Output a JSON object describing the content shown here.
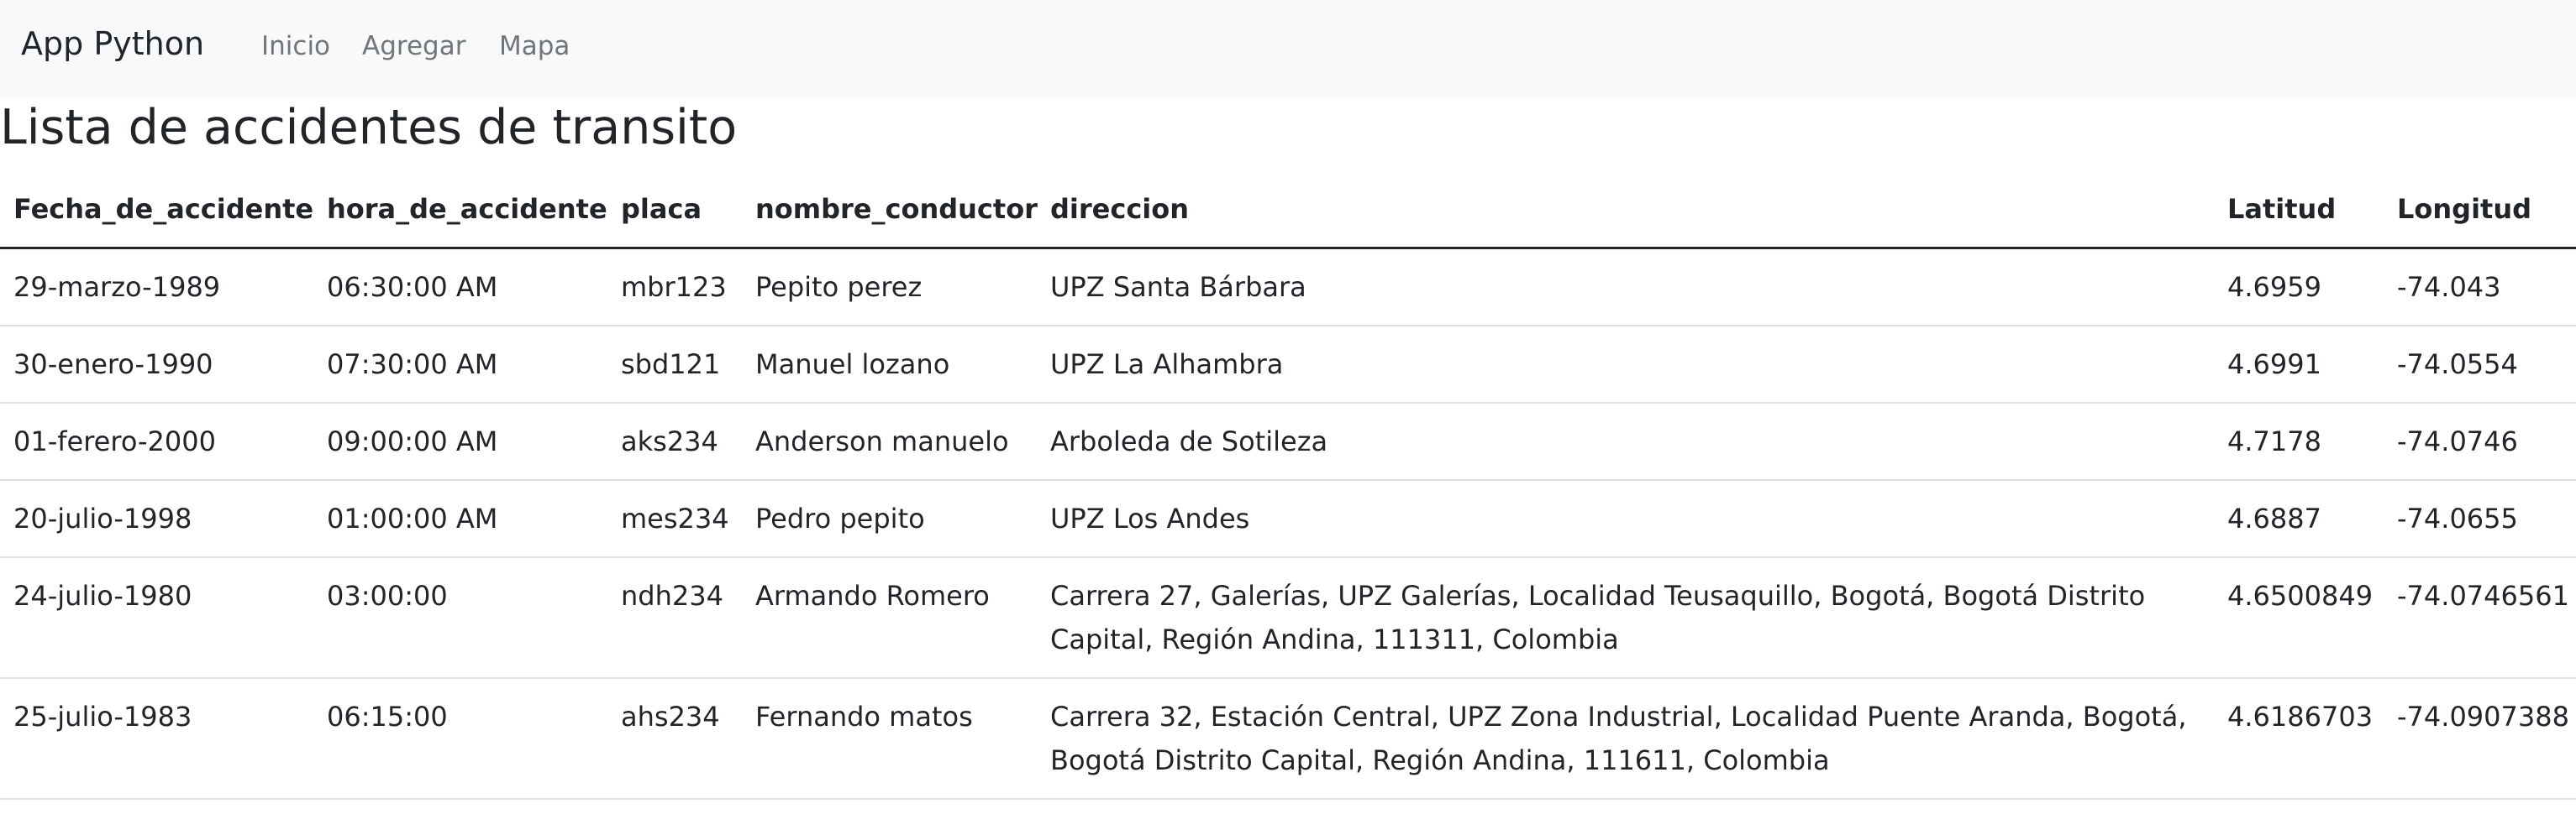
{
  "navbar": {
    "brand": "App Python",
    "links": [
      "Inicio",
      "Agregar",
      "Mapa"
    ]
  },
  "title": "Lista de accidentes de transito",
  "table": {
    "headers": [
      "Fecha_de_accidente",
      "hora_de_accidente",
      "placa",
      "nombre_conductor",
      "direccion",
      "Latitud",
      "Longitud"
    ],
    "rows": [
      [
        "29-marzo-1989",
        "06:30:00 AM",
        "mbr123",
        "Pepito perez",
        "UPZ Santa Bárbara",
        "4.6959",
        "-74.043"
      ],
      [
        "30-enero-1990",
        "07:30:00 AM",
        "sbd121",
        "Manuel lozano",
        "UPZ La Alhambra",
        "4.6991",
        "-74.0554"
      ],
      [
        "01-ferero-2000",
        "09:00:00 AM",
        "aks234",
        "Anderson manuelo",
        "Arboleda de Sotileza",
        "4.7178",
        "-74.0746"
      ],
      [
        "20-julio-1998",
        "01:00:00 AM",
        "mes234",
        "Pedro pepito",
        "UPZ Los Andes",
        "4.6887",
        "-74.0655"
      ],
      [
        "24-julio-1980",
        "03:00:00",
        "ndh234",
        "Armando Romero",
        "Carrera 27, Galerías, UPZ Galerías, Localidad Teusaquillo, Bogotá, Bogotá Distrito Capital, Región Andina, 111311, Colombia",
        "4.6500849",
        "-74.0746561"
      ],
      [
        "25-julio-1983",
        "06:15:00",
        "ahs234",
        "Fernando matos",
        "Carrera 32, Estación Central, UPZ Zona Industrial, Localidad Puente Aranda, Bogotá, Bogotá Distrito Capital, Región Andina, 111611, Colombia",
        "4.6186703",
        "-74.0907388"
      ]
    ]
  }
}
